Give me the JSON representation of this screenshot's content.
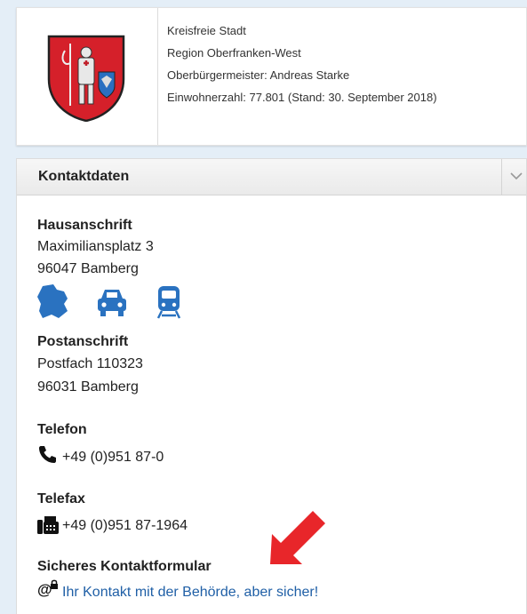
{
  "header_card": {
    "info_lines": [
      "Kreisfreie Stadt",
      "Region Oberfranken-West",
      "Oberbürgermeister: Andreas Starke",
      "Einwohnerzahl: 77.801 (Stand: 30. September 2018)"
    ]
  },
  "panel": {
    "title": "Kontaktdaten",
    "hausanschrift": {
      "heading": "Hausanschrift",
      "street": "Maximiliansplatz 3",
      "city": "96047 Bamberg"
    },
    "transport_icons": [
      "bavaria-map-icon",
      "car-icon",
      "train-icon"
    ],
    "postanschrift": {
      "heading": "Postanschrift",
      "box": "Postfach 110323",
      "city": "96031 Bamberg"
    },
    "telefon": {
      "heading": "Telefon",
      "value": "+49 (0)951 87-0"
    },
    "telefax": {
      "heading": "Telefax",
      "value": "+49 (0)951 87-1964"
    },
    "kontaktformular": {
      "heading": "Sicheres Kontaktformular",
      "link": "Ihr Kontakt mit der Behörde, aber sicher!"
    }
  },
  "colors": {
    "accent": "#1f5fa6",
    "icon_blue": "#2a72c0",
    "arrow": "#e8262a",
    "crest_red": "#d5202a",
    "background": "#e4eef7"
  }
}
